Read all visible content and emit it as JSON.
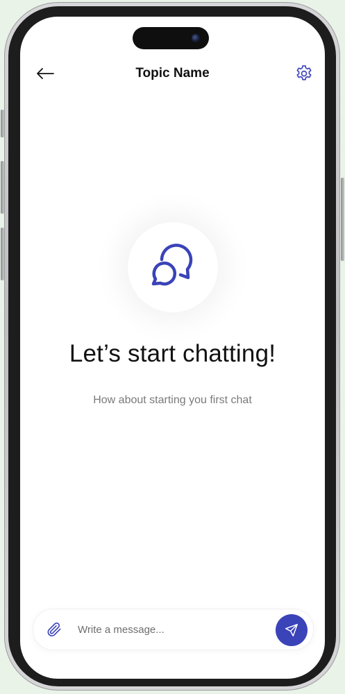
{
  "header": {
    "title": "Topic Name",
    "back_icon": "arrow-left-icon",
    "settings_icon": "gear-icon"
  },
  "empty_state": {
    "icon": "chat-bubbles-icon",
    "title": "Let’s start chatting!",
    "subtitle": "How about starting you first chat"
  },
  "composer": {
    "attach_icon": "paperclip-icon",
    "placeholder": "Write a message...",
    "value": "",
    "send_icon": "send-icon"
  },
  "colors": {
    "accent": "#3a43b8",
    "icon_stroke": "#3a43b8",
    "title_text": "#111111",
    "subtitle_text": "#7a7a7a"
  }
}
